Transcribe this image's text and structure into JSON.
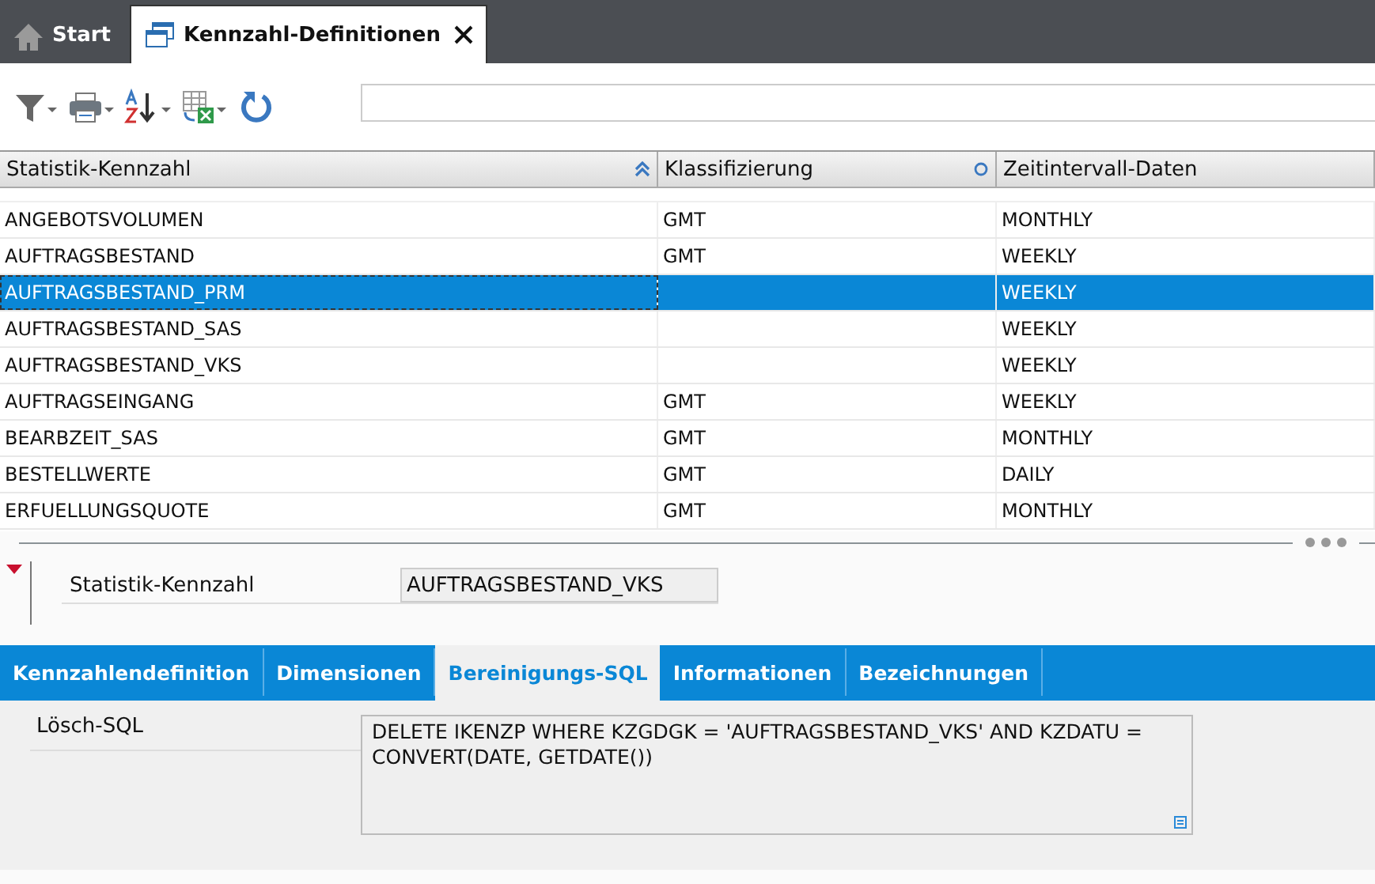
{
  "tabs": [
    {
      "label": "Start",
      "selected": false
    },
    {
      "label": "Kennzahl-Definitionen",
      "selected": true
    }
  ],
  "table": {
    "columns": [
      {
        "label": "Statistik-Kennzahl"
      },
      {
        "label": "Klassifizierung"
      },
      {
        "label": "Zeitintervall-Daten"
      }
    ],
    "rows": [
      {
        "cells": [
          "ANGEBOTSVOLUMEN",
          "GMT",
          "MONTHLY"
        ],
        "selected": false
      },
      {
        "cells": [
          "AUFTRAGSBESTAND",
          "GMT",
          "WEEKLY"
        ],
        "selected": false
      },
      {
        "cells": [
          "AUFTRAGSBESTAND_PRM",
          "",
          "WEEKLY"
        ],
        "selected": true
      },
      {
        "cells": [
          "AUFTRAGSBESTAND_SAS",
          "",
          "WEEKLY"
        ],
        "selected": false
      },
      {
        "cells": [
          "AUFTRAGSBESTAND_VKS",
          "",
          "WEEKLY"
        ],
        "selected": false
      },
      {
        "cells": [
          "AUFTRAGSEINGANG",
          "GMT",
          "WEEKLY"
        ],
        "selected": false
      },
      {
        "cells": [
          "BEARBZEIT_SAS",
          "GMT",
          "MONTHLY"
        ],
        "selected": false
      },
      {
        "cells": [
          "BESTELLWERTE",
          "GMT",
          "DAILY"
        ],
        "selected": false
      },
      {
        "cells": [
          "ERFUELLUNGSQUOTE",
          "GMT",
          "MONTHLY"
        ],
        "selected": false
      }
    ]
  },
  "detail": {
    "label": "Statistik-Kennzahl",
    "value": "AUFTRAGSBESTAND_VKS"
  },
  "detail_tabs": [
    {
      "label": "Kennzahlendefinition",
      "selected": false
    },
    {
      "label": "Dimensionen",
      "selected": false
    },
    {
      "label": "Bereinigungs-SQL",
      "selected": true
    },
    {
      "label": "Informationen",
      "selected": false
    },
    {
      "label": "Bezeichnungen",
      "selected": false
    }
  ],
  "sql": {
    "label": "Lösch-SQL",
    "value": "DELETE IKENZP WHERE KZGDGK = 'AUFTRAGSBESTAND_VKS' AND KZDATU = CONVERT(DATE, GETDATE())"
  }
}
